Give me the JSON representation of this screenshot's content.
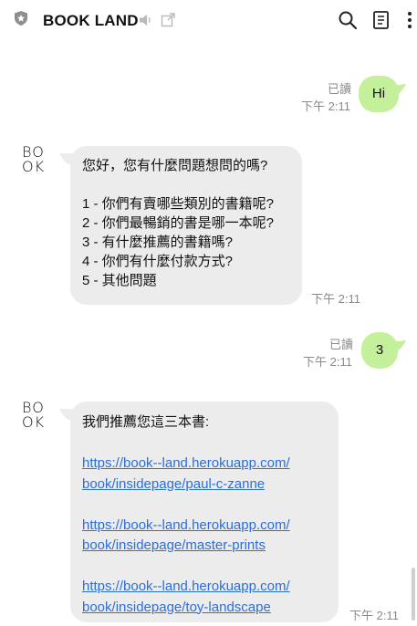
{
  "header": {
    "title": "BOOK LAND",
    "icons": [
      "shield-icon",
      "mute-icon",
      "external-link-icon",
      "search-icon",
      "notes-icon",
      "more-vertical-icon"
    ]
  },
  "avatar": {
    "line1": "BO",
    "line2": "OK"
  },
  "messages": [
    {
      "side": "right",
      "text": "Hi",
      "read": "已讀",
      "time": "下午 2:11"
    },
    {
      "side": "left",
      "lines": [
        "您好，您有什麼問題想問的嗎?",
        "",
        "1 - 你們有賣哪些類別的書籍呢?",
        "2 - 你們最暢銷的書是哪一本呢?",
        "3 - 有什麼推薦的書籍嗎?",
        "4 - 你們有什麼付款方式?",
        "5 - 其他問題"
      ],
      "time": "下午 2:11"
    },
    {
      "side": "right",
      "text": "3",
      "read": "已讀",
      "time": "下午 2:11"
    },
    {
      "side": "left",
      "intro": "我們推薦您這三本書:",
      "links": [
        {
          "line1": "https://book--land.herokuapp.com/",
          "line2": "book/insidepage/paul-c-zanne"
        },
        {
          "line1": "https://book--land.herokuapp.com/",
          "line2": "book/insidepage/master-prints"
        },
        {
          "line1": "https://book--land.herokuapp.com/",
          "line2": "book/insidepage/toy-landscape"
        }
      ],
      "time": "下午 2:11"
    }
  ],
  "colors": {
    "sent_bubble": "#c4f09b",
    "recv_bubble": "#ececec",
    "link": "#2a6ee0",
    "meta": "#8a8a8a"
  }
}
